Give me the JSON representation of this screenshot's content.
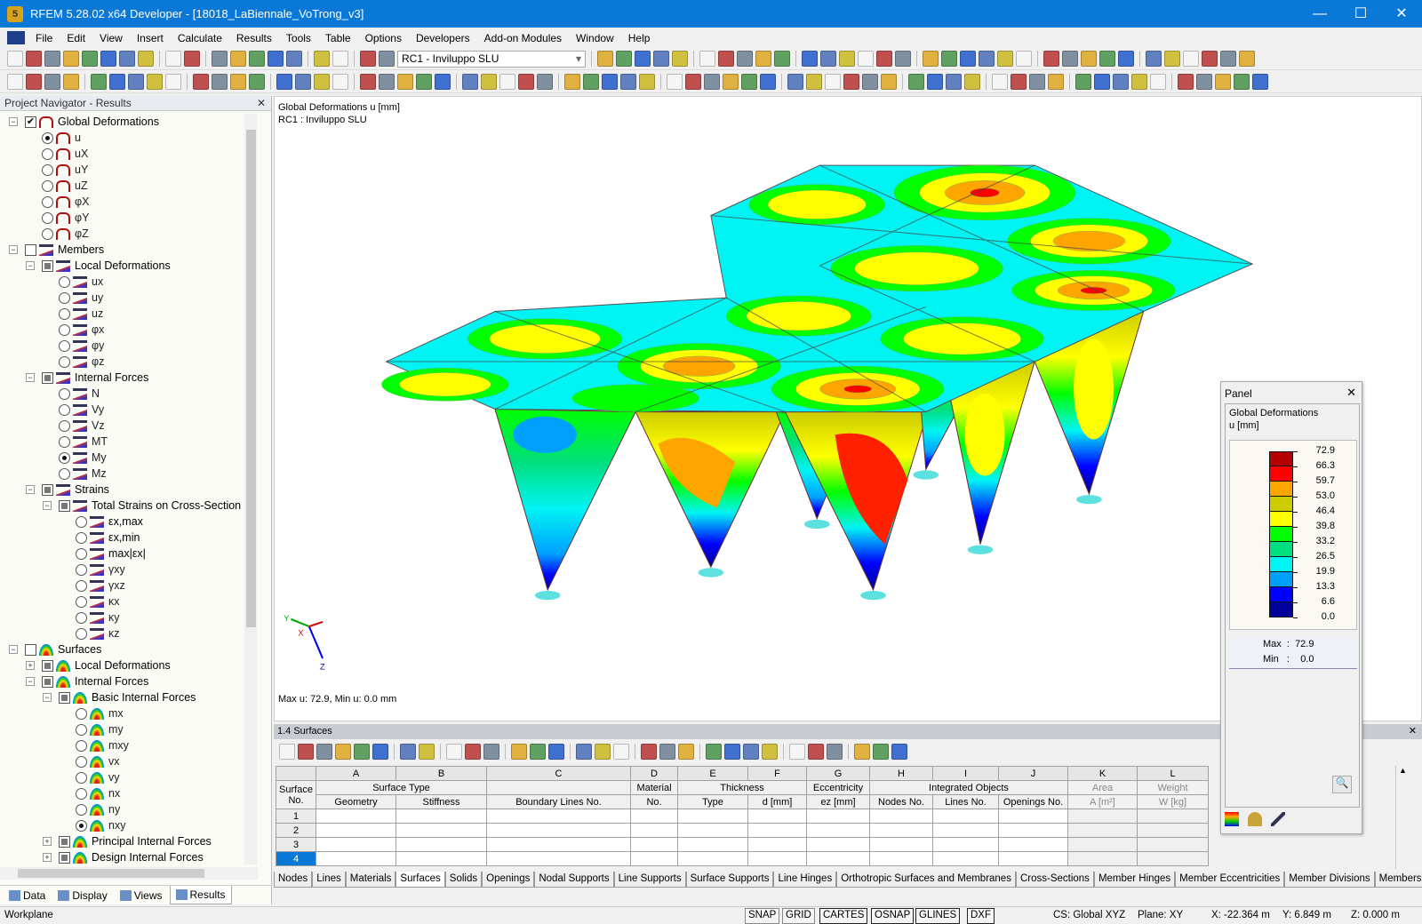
{
  "window": {
    "title": "RFEM 5.28.02 x64 Developer - [18018_LaBiennale_VoTrong_v3]",
    "minimize": "—",
    "maximize": "☐",
    "close": "✕"
  },
  "menu": [
    "File",
    "Edit",
    "View",
    "Insert",
    "Calculate",
    "Results",
    "Tools",
    "Table",
    "Options",
    "Developers",
    "Add-on Modules",
    "Window",
    "Help"
  ],
  "toolbar": {
    "load_case": "RC1 - Inviluppo SLU"
  },
  "navigator": {
    "title": "Project Navigator - Results",
    "items": [
      {
        "label": "Global Deformations",
        "lvl": 0,
        "exp": "-",
        "ctl": "chk",
        "state": "on",
        "icon": "def"
      },
      {
        "label": "u",
        "lvl": 1,
        "ctl": "rad",
        "state": "on",
        "icon": "def"
      },
      {
        "label": "uX",
        "lvl": 1,
        "ctl": "rad",
        "icon": "def"
      },
      {
        "label": "uY",
        "lvl": 1,
        "ctl": "rad",
        "icon": "def"
      },
      {
        "label": "uZ",
        "lvl": 1,
        "ctl": "rad",
        "icon": "def"
      },
      {
        "label": "φX",
        "lvl": 1,
        "ctl": "rad",
        "icon": "def"
      },
      {
        "label": "φY",
        "lvl": 1,
        "ctl": "rad",
        "icon": "def"
      },
      {
        "label": "φZ",
        "lvl": 1,
        "ctl": "rad",
        "icon": "def"
      },
      {
        "label": "Members",
        "lvl": 0,
        "exp": "-",
        "ctl": "chk",
        "icon": "mem"
      },
      {
        "label": "Local Deformations",
        "lvl": 1,
        "exp": "-",
        "ctl": "chk",
        "state": "part",
        "icon": "mem"
      },
      {
        "label": "ux",
        "lvl": 2,
        "ctl": "rad",
        "icon": "mem"
      },
      {
        "label": "uy",
        "lvl": 2,
        "ctl": "rad",
        "icon": "mem"
      },
      {
        "label": "uz",
        "lvl": 2,
        "ctl": "rad",
        "icon": "mem"
      },
      {
        "label": "φx",
        "lvl": 2,
        "ctl": "rad",
        "icon": "mem"
      },
      {
        "label": "φy",
        "lvl": 2,
        "ctl": "rad",
        "icon": "mem"
      },
      {
        "label": "φz",
        "lvl": 2,
        "ctl": "rad",
        "icon": "mem"
      },
      {
        "label": "Internal Forces",
        "lvl": 1,
        "exp": "-",
        "ctl": "chk",
        "state": "part",
        "icon": "mem"
      },
      {
        "label": "N",
        "lvl": 2,
        "ctl": "rad",
        "icon": "mem"
      },
      {
        "label": "Vy",
        "lvl": 2,
        "ctl": "rad",
        "icon": "mem"
      },
      {
        "label": "Vz",
        "lvl": 2,
        "ctl": "rad",
        "icon": "mem"
      },
      {
        "label": "MT",
        "lvl": 2,
        "ctl": "rad",
        "icon": "mem"
      },
      {
        "label": "My",
        "lvl": 2,
        "ctl": "rad",
        "state": "on",
        "icon": "mem"
      },
      {
        "label": "Mz",
        "lvl": 2,
        "ctl": "rad",
        "icon": "mem"
      },
      {
        "label": "Strains",
        "lvl": 1,
        "exp": "-",
        "ctl": "chk",
        "state": "part",
        "icon": "mem"
      },
      {
        "label": "Total Strains on Cross-Section",
        "lvl": 2,
        "exp": "-",
        "ctl": "chk",
        "state": "part",
        "icon": "mem"
      },
      {
        "label": "εx,max",
        "lvl": 3,
        "ctl": "rad",
        "icon": "mem"
      },
      {
        "label": "εx,min",
        "lvl": 3,
        "ctl": "rad",
        "icon": "mem"
      },
      {
        "label": "max|εx|",
        "lvl": 3,
        "ctl": "rad",
        "icon": "mem"
      },
      {
        "label": "γxy",
        "lvl": 3,
        "ctl": "rad",
        "icon": "mem"
      },
      {
        "label": "γxz",
        "lvl": 3,
        "ctl": "rad",
        "icon": "mem"
      },
      {
        "label": "κx",
        "lvl": 3,
        "ctl": "rad",
        "icon": "mem"
      },
      {
        "label": "κy",
        "lvl": 3,
        "ctl": "rad",
        "icon": "mem"
      },
      {
        "label": "κz",
        "lvl": 3,
        "ctl": "rad",
        "icon": "mem"
      },
      {
        "label": "Surfaces",
        "lvl": 0,
        "exp": "-",
        "ctl": "chk",
        "icon": "surf"
      },
      {
        "label": "Local Deformations",
        "lvl": 1,
        "exp": "+",
        "ctl": "chk",
        "state": "part",
        "icon": "surf"
      },
      {
        "label": "Internal Forces",
        "lvl": 1,
        "exp": "-",
        "ctl": "chk",
        "state": "part",
        "icon": "surf"
      },
      {
        "label": "Basic Internal Forces",
        "lvl": 2,
        "exp": "-",
        "ctl": "chk",
        "state": "part",
        "icon": "surf"
      },
      {
        "label": "mx",
        "lvl": 3,
        "ctl": "rad",
        "icon": "surf"
      },
      {
        "label": "my",
        "lvl": 3,
        "ctl": "rad",
        "icon": "surf"
      },
      {
        "label": "mxy",
        "lvl": 3,
        "ctl": "rad",
        "icon": "surf"
      },
      {
        "label": "vx",
        "lvl": 3,
        "ctl": "rad",
        "icon": "surf"
      },
      {
        "label": "vy",
        "lvl": 3,
        "ctl": "rad",
        "icon": "surf"
      },
      {
        "label": "nx",
        "lvl": 3,
        "ctl": "rad",
        "icon": "surf"
      },
      {
        "label": "ny",
        "lvl": 3,
        "ctl": "rad",
        "icon": "surf"
      },
      {
        "label": "nxy",
        "lvl": 3,
        "ctl": "rad",
        "state": "on",
        "icon": "surf"
      },
      {
        "label": "Principal Internal Forces",
        "lvl": 2,
        "exp": "+",
        "ctl": "chk",
        "state": "part",
        "icon": "surf"
      },
      {
        "label": "Design Internal Forces",
        "lvl": 2,
        "exp": "+",
        "ctl": "chk",
        "state": "part",
        "icon": "surf"
      }
    ],
    "tabs": [
      "Data",
      "Display",
      "Views",
      "Results"
    ],
    "active_tab": "Results"
  },
  "viewport": {
    "title": "Global Deformations u [mm]",
    "load_case": "RC1 : Inviluppo SLU",
    "footer": "Max u: 72.9, Min u: 0.0 mm",
    "axes": {
      "x": "X",
      "y": "Y",
      "z": "Z"
    }
  },
  "panel": {
    "title": "Panel",
    "result": "Global Deformations",
    "unit": "u [mm]",
    "levels": [
      "72.9",
      "66.3",
      "59.7",
      "53.0",
      "46.4",
      "39.8",
      "33.2",
      "26.5",
      "19.9",
      "13.3",
      "6.6",
      "0.0"
    ],
    "colors": [
      "#b40000",
      "#ff0000",
      "#ffa500",
      "#cccc00",
      "#ffff00",
      "#00ff00",
      "#00e080",
      "#00f4f4",
      "#00a0ff",
      "#0000ff",
      "#00009a"
    ],
    "max_label": "Max",
    "max": "72.9",
    "min_label": "Min",
    "min": "0.0"
  },
  "table": {
    "title": "1.4 Surfaces",
    "letters": [
      "A",
      "B",
      "C",
      "D",
      "E",
      "F",
      "G",
      "H",
      "I",
      "J",
      "K",
      "L"
    ],
    "row_header": [
      "Surface",
      "No."
    ],
    "groups": {
      "surface_type": "Surface Type",
      "material": "Material",
      "thickness": "Thickness",
      "eccentricity": "Eccentricity",
      "integrated": "Integrated Objects",
      "area": "Area",
      "weight": "Weight"
    },
    "subheaders": {
      "geometry": "Geometry",
      "stiffness": "Stiffness",
      "boundary": "Boundary Lines No.",
      "material_no": "No.",
      "type": "Type",
      "d": "d [mm]",
      "ez": "ez [mm]",
      "nodes": "Nodes No.",
      "lines": "Lines No.",
      "openings": "Openings No.",
      "area": "A [m²]",
      "weight": "W [kg]"
    },
    "rows": [
      "1",
      "2",
      "3",
      "4"
    ],
    "selected_row": "4",
    "tabs": [
      "Nodes",
      "Lines",
      "Materials",
      "Surfaces",
      "Solids",
      "Openings",
      "Nodal Supports",
      "Line Supports",
      "Surface Supports",
      "Line Hinges",
      "Orthotropic Surfaces and Membranes",
      "Cross-Sections",
      "Member Hinges",
      "Member Eccentricities",
      "Member Divisions",
      "Members"
    ],
    "active_tab": "Surfaces"
  },
  "status": {
    "left": "Workplane",
    "toggles": [
      "SNAP",
      "GRID",
      "CARTES",
      "OSNAP",
      "GLINES",
      "DXF"
    ],
    "active": [
      "CARTES",
      "OSNAP",
      "GLINES",
      "DXF"
    ],
    "cs": "CS: Global XYZ",
    "plane": "Plane: XY",
    "x": "X: -22.364 m",
    "y": "Y: 6.849 m",
    "z": "Z: 0.000 m"
  }
}
